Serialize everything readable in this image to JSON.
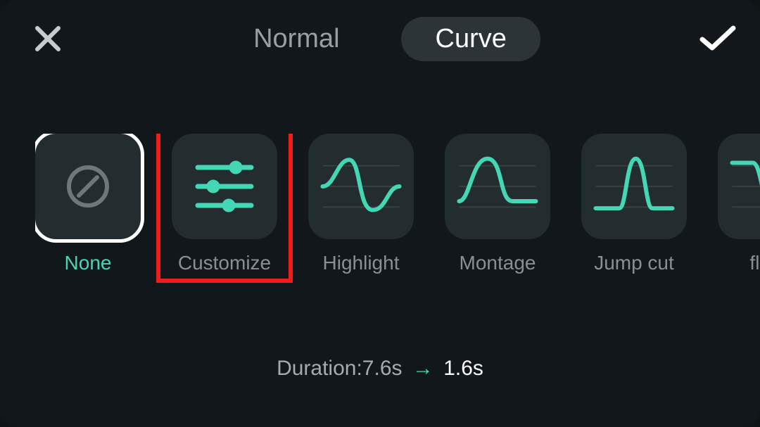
{
  "header": {
    "tabs": {
      "normal": "Normal",
      "curve": "Curve"
    }
  },
  "options": {
    "none": "None",
    "customize": "Customize",
    "highlight": "Highlight",
    "montage": "Montage",
    "jumpcut": "Jump cut",
    "flash": "flash"
  },
  "duration": {
    "label": "Duration:",
    "from": "7.6s",
    "arrow": "→",
    "to": "1.6s"
  },
  "colors": {
    "accent": "#44d7b6",
    "highlight_box": "#f11c1c"
  }
}
